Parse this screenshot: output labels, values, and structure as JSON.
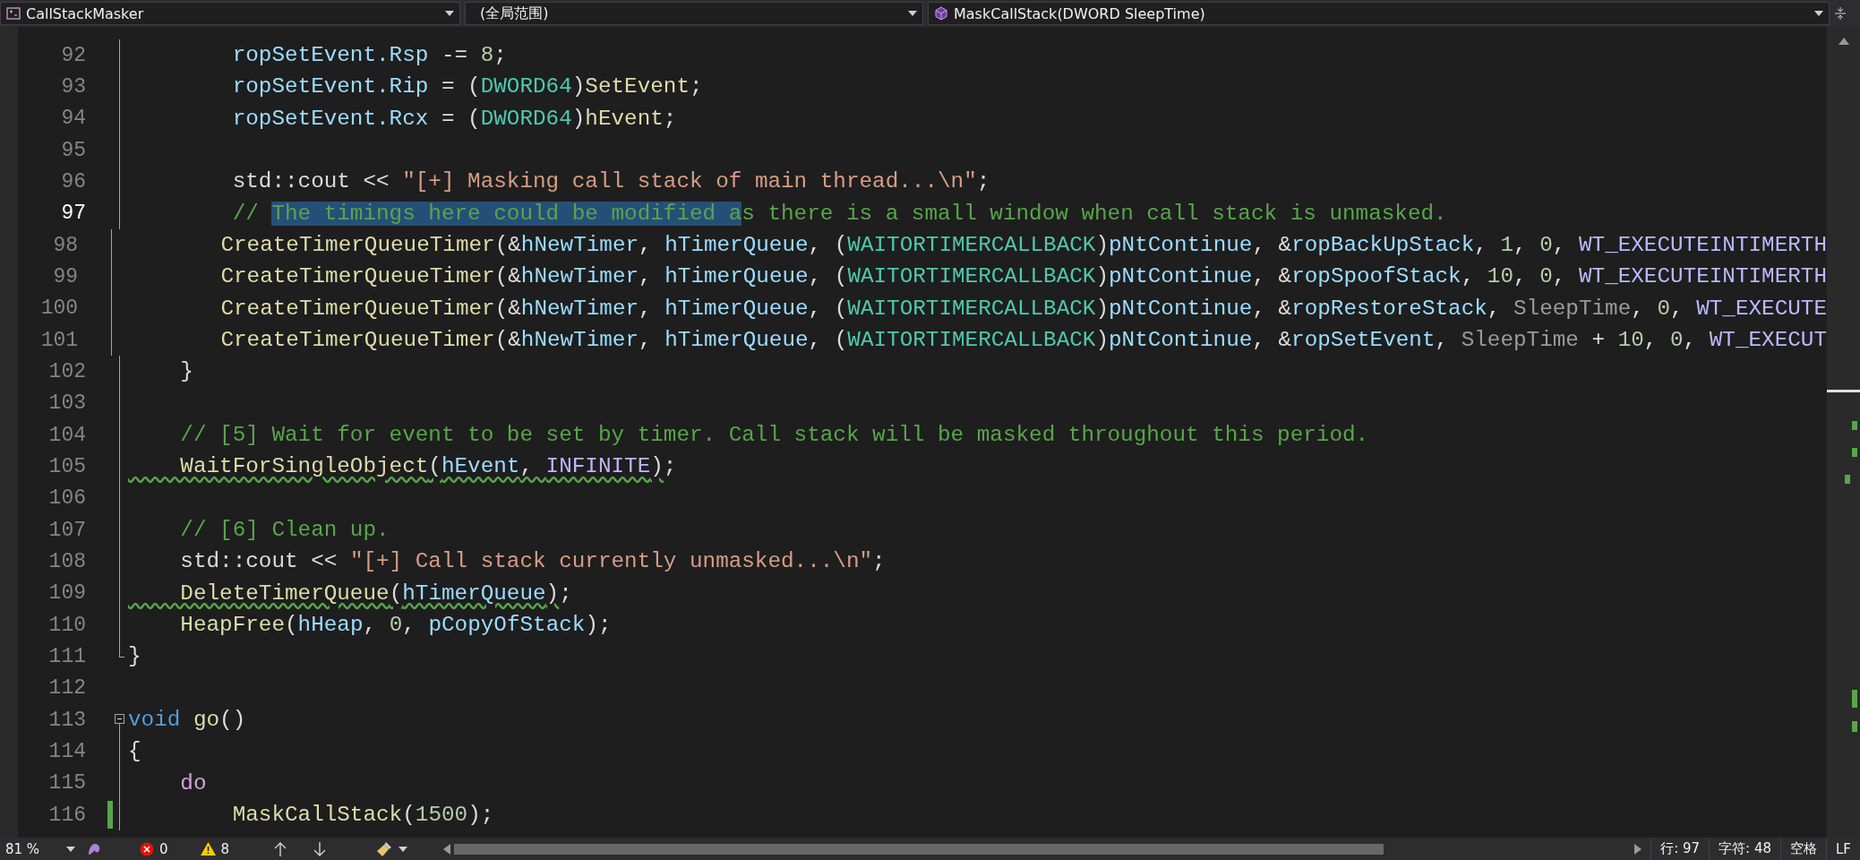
{
  "toolbar": {
    "project": "CallStackMasker",
    "scope": "(全局范围)",
    "member": "MaskCallStack(DWORD SleepTime)"
  },
  "editor": {
    "lines": [
      {
        "number": "92",
        "current": false,
        "changed": false,
        "kind": "inner",
        "tokens": [
          {
            "kind": "var",
            "text": "        ropSetEvent.Rsp"
          },
          {
            "kind": "plain",
            "text": " -= "
          },
          {
            "kind": "number",
            "text": "8"
          },
          {
            "kind": "plain",
            "text": ";"
          }
        ]
      },
      {
        "number": "93",
        "current": false,
        "changed": false,
        "kind": "inner",
        "tokens": [
          {
            "kind": "var",
            "text": "        ropSetEvent.Rip"
          },
          {
            "kind": "plain",
            "text": " = ("
          },
          {
            "kind": "type",
            "text": "DWORD64"
          },
          {
            "kind": "plain",
            "text": ")"
          },
          {
            "kind": "func",
            "text": "SetEvent"
          },
          {
            "kind": "plain",
            "text": ";"
          }
        ]
      },
      {
        "number": "94",
        "current": false,
        "changed": false,
        "kind": "inner",
        "tokens": [
          {
            "kind": "var",
            "text": "        ropSetEvent.Rcx"
          },
          {
            "kind": "plain",
            "text": " = ("
          },
          {
            "kind": "type",
            "text": "DWORD64"
          },
          {
            "kind": "plain",
            "text": ")"
          },
          {
            "kind": "func",
            "text": "hEvent"
          },
          {
            "kind": "plain",
            "text": ";"
          }
        ]
      },
      {
        "number": "95",
        "current": false,
        "changed": false,
        "kind": "inner"
      },
      {
        "number": "96",
        "current": false,
        "changed": false,
        "kind": "inner",
        "tokens": [
          {
            "kind": "plain",
            "text": "        std::cout << "
          },
          {
            "kind": "string",
            "text": "\"[+] Masking call stack of main thread...\\n\""
          },
          {
            "kind": "plain",
            "text": ";"
          }
        ]
      },
      {
        "number": "97",
        "current": true,
        "changed": false,
        "kind": "inner",
        "tokens": [
          {
            "kind": "comment",
            "text": "        // "
          },
          {
            "kind": "selection",
            "text": "The timings here could be modified a"
          },
          {
            "kind": "comment",
            "text": "s there is a small window when call stack is unmasked."
          }
        ]
      },
      {
        "number": "98",
        "current": false,
        "changed": false,
        "kind": "inner",
        "tokens": [
          {
            "kind": "func",
            "text": "        CreateTimerQueueTimer"
          },
          {
            "kind": "plain",
            "text": "(&"
          },
          {
            "kind": "var",
            "text": "hNewTimer"
          },
          {
            "kind": "plain",
            "text": ", "
          },
          {
            "kind": "var",
            "text": "hTimerQueue"
          },
          {
            "kind": "plain",
            "text": ", ("
          },
          {
            "kind": "type",
            "text": "WAITORTIMERCALLBACK"
          },
          {
            "kind": "plain",
            "text": ")"
          },
          {
            "kind": "var",
            "text": "pNtContinue"
          },
          {
            "kind": "plain",
            "text": ", &"
          },
          {
            "kind": "var",
            "text": "ropBackUpStack"
          },
          {
            "kind": "plain",
            "text": ", "
          },
          {
            "kind": "number",
            "text": "1"
          },
          {
            "kind": "plain",
            "text": ", "
          },
          {
            "kind": "number",
            "text": "0"
          },
          {
            "kind": "plain",
            "text": ", "
          },
          {
            "kind": "macro",
            "text": "WT_EXECUTEINTIMERTH"
          }
        ]
      },
      {
        "number": "99",
        "current": false,
        "changed": false,
        "kind": "inner",
        "tokens": [
          {
            "kind": "func",
            "text": "        CreateTimerQueueTimer"
          },
          {
            "kind": "plain",
            "text": "(&"
          },
          {
            "kind": "var",
            "text": "hNewTimer"
          },
          {
            "kind": "plain",
            "text": ", "
          },
          {
            "kind": "var",
            "text": "hTimerQueue"
          },
          {
            "kind": "plain",
            "text": ", ("
          },
          {
            "kind": "type",
            "text": "WAITORTIMERCALLBACK"
          },
          {
            "kind": "plain",
            "text": ")"
          },
          {
            "kind": "var",
            "text": "pNtContinue"
          },
          {
            "kind": "plain",
            "text": ", &"
          },
          {
            "kind": "var",
            "text": "ropSpoofStack"
          },
          {
            "kind": "plain",
            "text": ", "
          },
          {
            "kind": "number",
            "text": "10"
          },
          {
            "kind": "plain",
            "text": ", "
          },
          {
            "kind": "number",
            "text": "0"
          },
          {
            "kind": "plain",
            "text": ", "
          },
          {
            "kind": "macro",
            "text": "WT_EXECUTEINTIMERTH"
          }
        ]
      },
      {
        "number": "100",
        "current": false,
        "changed": false,
        "kind": "inner",
        "tokens": [
          {
            "kind": "func",
            "text": "        CreateTimerQueueTimer"
          },
          {
            "kind": "plain",
            "text": "(&"
          },
          {
            "kind": "var",
            "text": "hNewTimer"
          },
          {
            "kind": "plain",
            "text": ", "
          },
          {
            "kind": "var",
            "text": "hTimerQueue"
          },
          {
            "kind": "plain",
            "text": ", ("
          },
          {
            "kind": "type",
            "text": "WAITORTIMERCALLBACK"
          },
          {
            "kind": "plain",
            "text": ")"
          },
          {
            "kind": "var",
            "text": "pNtContinue"
          },
          {
            "kind": "plain",
            "text": ", &"
          },
          {
            "kind": "var",
            "text": "ropRestoreStack"
          },
          {
            "kind": "plain",
            "text": ", "
          },
          {
            "kind": "param",
            "text": "SleepTime"
          },
          {
            "kind": "plain",
            "text": ", "
          },
          {
            "kind": "number",
            "text": "0"
          },
          {
            "kind": "plain",
            "text": ", "
          },
          {
            "kind": "macro",
            "text": "WT_EXECUTE"
          }
        ]
      },
      {
        "number": "101",
        "current": false,
        "changed": false,
        "kind": "inner",
        "tokens": [
          {
            "kind": "func",
            "text": "        CreateTimerQueueTimer"
          },
          {
            "kind": "plain",
            "text": "(&"
          },
          {
            "kind": "var",
            "text": "hNewTimer"
          },
          {
            "kind": "plain",
            "text": ", "
          },
          {
            "kind": "var",
            "text": "hTimerQueue"
          },
          {
            "kind": "plain",
            "text": ", ("
          },
          {
            "kind": "type",
            "text": "WAITORTIMERCALLBACK"
          },
          {
            "kind": "plain",
            "text": ")"
          },
          {
            "kind": "var",
            "text": "pNtContinue"
          },
          {
            "kind": "plain",
            "text": ", &"
          },
          {
            "kind": "var",
            "text": "ropSetEvent"
          },
          {
            "kind": "plain",
            "text": ", "
          },
          {
            "kind": "param",
            "text": "SleepTime"
          },
          {
            "kind": "plain",
            "text": " + "
          },
          {
            "kind": "number",
            "text": "10"
          },
          {
            "kind": "plain",
            "text": ", "
          },
          {
            "kind": "number",
            "text": "0"
          },
          {
            "kind": "plain",
            "text": ", "
          },
          {
            "kind": "macro",
            "text": "WT_EXECUT"
          }
        ]
      },
      {
        "number": "102",
        "current": false,
        "changed": false,
        "kind": "inner",
        "tokens": [
          {
            "kind": "plain",
            "text": "    }"
          }
        ]
      },
      {
        "number": "103",
        "current": false,
        "changed": false,
        "kind": "inner"
      },
      {
        "number": "104",
        "current": false,
        "changed": false,
        "kind": "inner",
        "tokens": [
          {
            "kind": "comment",
            "text": "    // [5] Wait for event to be set by timer. Call stack will be masked throughout this period."
          }
        ]
      },
      {
        "number": "105",
        "current": false,
        "changed": false,
        "kind": "inner",
        "tokens": [
          {
            "kind": "func",
            "text": "    WaitForSingleObject",
            "squiggle": true
          },
          {
            "kind": "plain",
            "text": "(",
            "squiggle": true
          },
          {
            "kind": "var",
            "text": "hEvent",
            "squiggle": true
          },
          {
            "kind": "plain",
            "text": ", ",
            "squiggle": true
          },
          {
            "kind": "macro",
            "text": "INFINITE",
            "squiggle": true
          },
          {
            "kind": "plain",
            "text": ")",
            "squiggle": true
          },
          {
            "kind": "plain",
            "text": ";"
          }
        ]
      },
      {
        "number": "106",
        "current": false,
        "changed": false,
        "kind": "inner"
      },
      {
        "number": "107",
        "current": false,
        "changed": false,
        "kind": "inner",
        "tokens": [
          {
            "kind": "comment",
            "text": "    // [6] Clean up."
          }
        ]
      },
      {
        "number": "108",
        "current": false,
        "changed": false,
        "kind": "inner",
        "tokens": [
          {
            "kind": "plain",
            "text": "    std::cout << "
          },
          {
            "kind": "string",
            "text": "\"[+] Call stack currently unmasked...\\n\""
          },
          {
            "kind": "plain",
            "text": ";"
          }
        ]
      },
      {
        "number": "109",
        "current": false,
        "changed": false,
        "kind": "inner",
        "tokens": [
          {
            "kind": "func",
            "text": "    DeleteTimerQueue",
            "squiggle": true
          },
          {
            "kind": "plain",
            "text": "(",
            "squiggle": true
          },
          {
            "kind": "var",
            "text": "hTimerQueue",
            "squiggle": true
          },
          {
            "kind": "plain",
            "text": ")",
            "squiggle": true
          },
          {
            "kind": "plain",
            "text": ";"
          }
        ]
      },
      {
        "number": "110",
        "current": false,
        "changed": false,
        "kind": "inner",
        "tokens": [
          {
            "kind": "func",
            "text": "    HeapFree"
          },
          {
            "kind": "plain",
            "text": "("
          },
          {
            "kind": "var",
            "text": "hHeap"
          },
          {
            "kind": "plain",
            "text": ", "
          },
          {
            "kind": "number",
            "text": "0"
          },
          {
            "kind": "plain",
            "text": ", "
          },
          {
            "kind": "var",
            "text": "pCopyOfStack"
          },
          {
            "kind": "plain",
            "text": ");"
          }
        ]
      },
      {
        "number": "111",
        "current": false,
        "changed": false,
        "kind": "closing",
        "tokens": [
          {
            "kind": "plain",
            "text": "}"
          }
        ]
      },
      {
        "number": "112",
        "current": false,
        "changed": false,
        "kind": "outside"
      },
      {
        "number": "113",
        "current": false,
        "changed": false,
        "kind": "header",
        "tokens": [
          {
            "kind": "keyword",
            "text": "void "
          },
          {
            "kind": "func",
            "text": "go"
          },
          {
            "kind": "plain",
            "text": "()"
          }
        ]
      },
      {
        "number": "114",
        "current": false,
        "changed": false,
        "kind": "inner",
        "tokens": [
          {
            "kind": "plain",
            "text": "{"
          }
        ]
      },
      {
        "number": "115",
        "current": false,
        "changed": false,
        "kind": "inner",
        "tokens": [
          {
            "kind": "control",
            "text": "    do"
          }
        ]
      },
      {
        "number": "116",
        "current": false,
        "changed": true,
        "kind": "inner",
        "tokens": [
          {
            "kind": "func",
            "text": "        MaskCallStack"
          },
          {
            "kind": "plain",
            "text": "("
          },
          {
            "kind": "number",
            "text": "1500"
          },
          {
            "kind": "plain",
            "text": ");"
          }
        ]
      }
    ]
  },
  "status_bar": {
    "zoom": "81 %",
    "errors": "0",
    "warnings": "8",
    "line": "行: 97",
    "column": "字符: 48",
    "indent": "空格",
    "line_ending": "LF"
  }
}
